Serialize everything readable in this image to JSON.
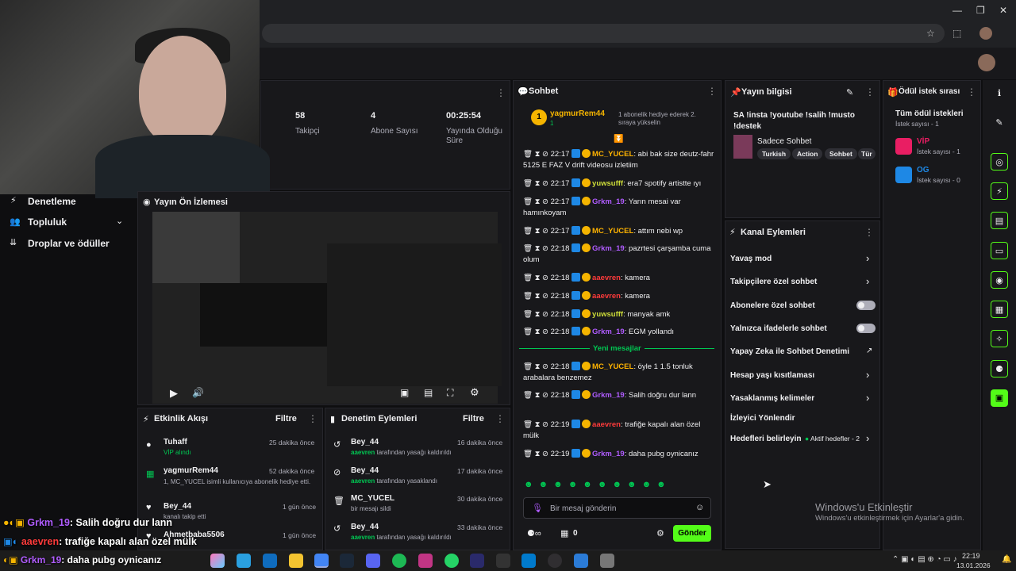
{
  "browser": {
    "window_controls": [
      "—",
      "❐",
      "✕"
    ],
    "icons": [
      "☆",
      "⬚"
    ]
  },
  "stats": [
    {
      "value": "58",
      "label": "Takipçi"
    },
    {
      "value": "4",
      "label": "Abone Sayısı"
    },
    {
      "value": "00:25:54",
      "label": "Yayında Olduğu Süre"
    }
  ],
  "sidebar": {
    "items": [
      {
        "label": "Denetleme"
      },
      {
        "label": "Topluluk"
      },
      {
        "label": "Droplar ve ödüller"
      }
    ]
  },
  "preview": {
    "title": "Yayın Ön İzlemesi"
  },
  "activity": {
    "title": "Etkinlik Akışı",
    "filter": "Filtre",
    "items": [
      {
        "name": "Tuhaff",
        "sub": "VİP alındı",
        "time": "25 dakika önce"
      },
      {
        "name": "yagmurRem44",
        "sub": "1, MC_YUCEL isimli kullanıcıya abonelik hediye etti.",
        "time": "52 dakika önce"
      },
      {
        "name": "Bey_44",
        "sub": "kanalı takip etti",
        "time": "1 gün önce"
      },
      {
        "name": "Ahmetbaba5506",
        "sub": "",
        "time": "1 gün önce"
      }
    ]
  },
  "modactions": {
    "title": "Denetim Eylemleri",
    "filter": "Filtre",
    "items": [
      {
        "name": "Bey_44",
        "sub_user": "aaevren",
        "sub": " tarafından yasağı kaldırıldı",
        "time": "16 dakika önce"
      },
      {
        "name": "Bey_44",
        "sub_user": "aaevren",
        "sub": " tarafından yasaklandı",
        "time": "17 dakika önce"
      },
      {
        "name": "MC_YUCEL",
        "sub_user": "",
        "sub": "bir mesajı sildi",
        "time": "30 dakika önce"
      },
      {
        "name": "Bey_44",
        "sub_user": "aaevren",
        "sub": " tarafından yasağı kaldırıldı",
        "time": "33 dakika önce"
      }
    ]
  },
  "chat": {
    "title": "Sohbet",
    "pinned": {
      "user": "yagmurRem44",
      "count": "1",
      "text": "1 abonelik hediye ederek 2. sıraya yükselin"
    },
    "messages": [
      {
        "time": "22:17",
        "user": "MC_YUCEL",
        "color": "#ffb300",
        "text": ": abi bak size deutz-fahr 5125 E FAZ V drift videosu izletiim"
      },
      {
        "time": "22:17",
        "user": "yuwsufff",
        "color": "#cddc39",
        "text": ": era7 spotify artistte ıyı"
      },
      {
        "time": "22:17",
        "user": "Grkm_19",
        "color": "#b05cff",
        "text": ": Yarın mesai var hamınkoyam"
      },
      {
        "time": "22:17",
        "user": "MC_YUCEL",
        "color": "#ffb300",
        "text": ": attım nebi wp"
      },
      {
        "time": "22:18",
        "user": "Grkm_19",
        "color": "#b05cff",
        "text": ": pazrtesi çarşamba cuma olum"
      },
      {
        "time": "22:18",
        "user": "aaevren",
        "color": "#ff3b3b",
        "text": ": kamera"
      },
      {
        "time": "22:18",
        "user": "aaevren",
        "color": "#ff3b3b",
        "text": ": kamera"
      },
      {
        "time": "22:18",
        "user": "yuwsufff",
        "color": "#cddc39",
        "text": ": manyak amk"
      },
      {
        "time": "22:18",
        "user": "Grkm_19",
        "color": "#b05cff",
        "text": ": EGM yollandı"
      }
    ],
    "new_messages_label": "Yeni mesajlar",
    "messages_new": [
      {
        "time": "22:18",
        "user": "MC_YUCEL",
        "color": "#ffb300",
        "text": ": öyle 1 1.5 tonluk arabalara benzemez"
      },
      {
        "time": "22:18",
        "user": "Grkm_19",
        "color": "#b05cff",
        "text": ": Salih doğru dur lann"
      },
      {
        "time": "22:19",
        "user": "aaevren",
        "color": "#ff3b3b",
        "text": ": trafiğe kapalı alan özel mülk"
      },
      {
        "time": "22:19",
        "user": "Grkm_19",
        "color": "#b05cff",
        "text": ": daha pubg oynicanız"
      }
    ],
    "input_placeholder": "Bir mesaj gönderin",
    "points": "0",
    "send_label": "Gönder"
  },
  "stream_info": {
    "title": "Yayın bilgisi",
    "stream_title": "SA !insta !youtube !salih !musto !destek",
    "category": "Sadece Sohbet",
    "tags": [
      "Turkish",
      "Action",
      "Sohbet",
      "Tür"
    ]
  },
  "channel_actions": {
    "title": "Kanal Eylemleri",
    "items": [
      {
        "label": "Yavaş mod"
      },
      {
        "label": "Takipçilere özel sohbet"
      },
      {
        "label": "Abonelere özel sohbet"
      },
      {
        "label": "Yalnızca ifadelerle sohbet"
      },
      {
        "label": "Yapay Zeka ile Sohbet Denetimi"
      },
      {
        "label": "Hesap yaşı kısıtlaması"
      },
      {
        "label": "Yasaklanmış kelimeler"
      },
      {
        "label": "İzleyici Yönlendir"
      },
      {
        "label": "Hedefleri belirleyin"
      }
    ],
    "goals_status": "Aktif hedefler - 2"
  },
  "rewards": {
    "title": "Ödül istek sırası",
    "all_label": "Tüm ödül istekleri",
    "all_count": "İstek sayısı - 1",
    "items": [
      {
        "name": "VİP",
        "count": "İstek sayısı - 1",
        "color": "#e91e63"
      },
      {
        "name": "OG",
        "count": "İstek sayısı - 0",
        "color": "#1e88e5"
      }
    ]
  },
  "overlay": [
    {
      "user": "Grkm_19",
      "color": "#b05cff",
      "text": ": Salih doğru dur lann"
    },
    {
      "user": "aaevren",
      "color": "#ff3b3b",
      "text": ": trafiğe kapalı alan özel mülk"
    },
    {
      "user": "Grkm_19",
      "color": "#b05cff",
      "text": ": daha pubg oynicanız"
    }
  ],
  "windows": {
    "title": "Windows'u Etkinleştir",
    "sub": "Windows'u etkinleştirmek için Ayarlar'a gidin."
  },
  "clock": {
    "time": "22:19",
    "date": "13.01.2026"
  }
}
